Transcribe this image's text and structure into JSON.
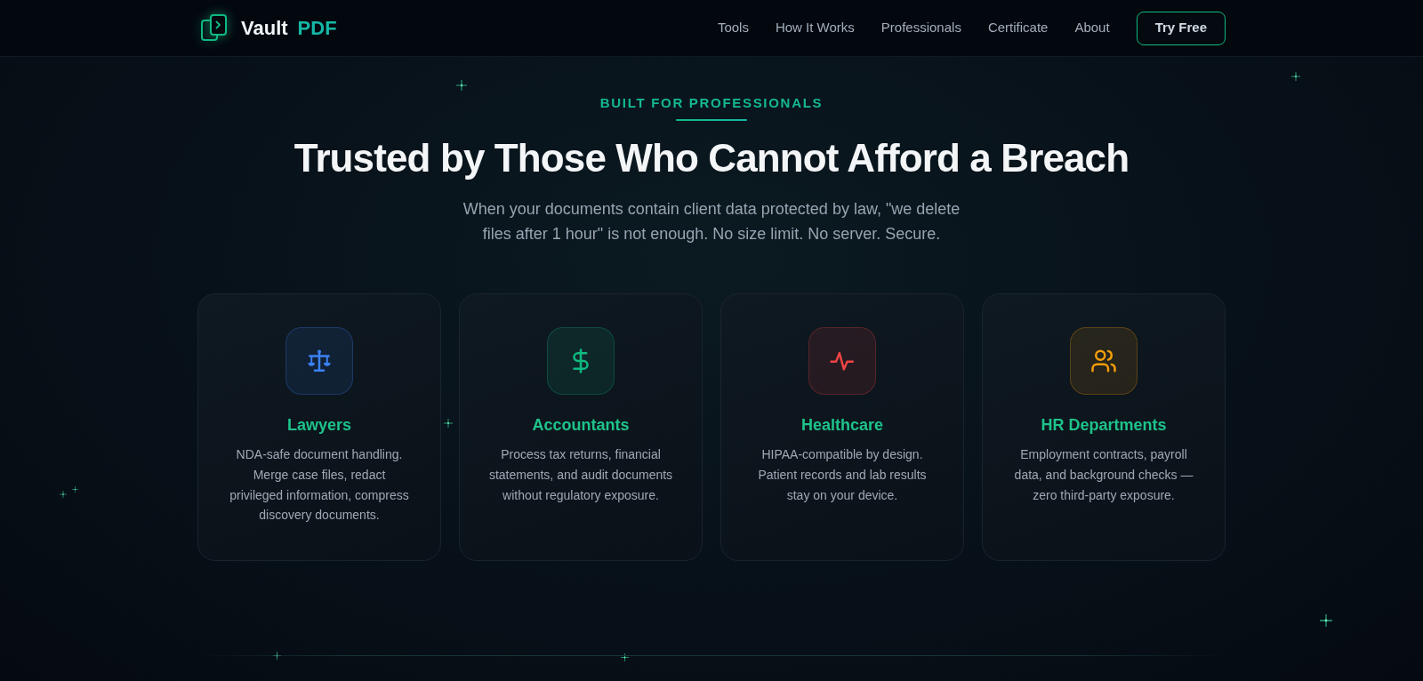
{
  "header": {
    "brand": {
      "name": "Vault",
      "accent": "PDF"
    },
    "nav": [
      "Tools",
      "How It Works",
      "Professionals",
      "Certificate",
      "About"
    ],
    "cta": "Try Free"
  },
  "hero": {
    "eyebrow": "BUILT FOR PROFESSIONALS",
    "title": "Trusted by Those Who Cannot Afford a Breach",
    "subtitle": "When your documents contain client data protected by law, \"we delete files after 1 hour\" is not enough. No size limit. No server. Secure."
  },
  "cards": [
    {
      "title": "Lawyers",
      "description": "NDA-safe document handling. Merge case files, redact privileged information, compress discovery documents.",
      "color": "#3b82f6"
    },
    {
      "title": "Accountants",
      "description": "Process tax returns, financial statements, and audit documents without regulatory exposure.",
      "color": "#10b981"
    },
    {
      "title": "Healthcare",
      "description": "HIPAA-compatible by design. Patient records and lab results stay on your device.",
      "color": "#ef4444"
    },
    {
      "title": "HR Departments",
      "description": "Employment contracts, payroll data, and background checks — zero third-party exposure.",
      "color": "#f59e0b"
    }
  ]
}
